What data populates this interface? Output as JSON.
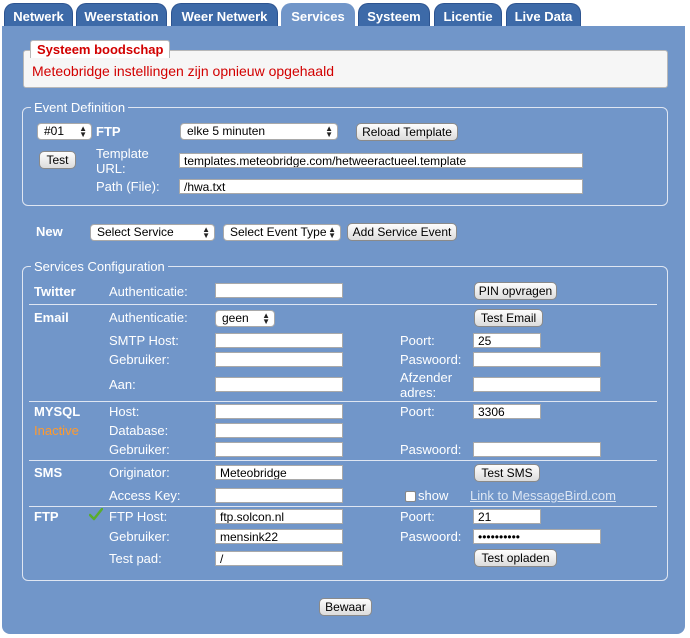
{
  "tabs": [
    "Netwerk",
    "Weerstation",
    "Weer Netwerk",
    "Services",
    "Systeem",
    "Licentie",
    "Live Data"
  ],
  "message": {
    "title": "Systeem boodschap",
    "text": "Meteobridge instellingen zijn opnieuw opgehaald"
  },
  "event": {
    "legend": "Event Definition",
    "number": "#01",
    "type_label": "FTP",
    "interval": "elke 5 minuten",
    "reload_label": "Reload Template",
    "test_label": "Test",
    "template_label_1": "Template",
    "template_label_2": "URL:",
    "template_url": "templates.meteobridge.com/hetweeractueel.template",
    "path_label": "Path (File):",
    "path_value": "/hwa.txt"
  },
  "new_row": {
    "label": "New",
    "service_select": "Select Service",
    "event_type_select": "Select Event Type",
    "add_label": "Add Service Event"
  },
  "services": {
    "legend": "Services Configuration",
    "twitter": {
      "label": "Twitter",
      "auth_label": "Authenticatie:",
      "auth_value": "",
      "pin_label": "PIN opvragen"
    },
    "email": {
      "label": "Email",
      "auth_label": "Authenticatie:",
      "auth_value": "geen",
      "test_label": "Test Email",
      "smtp_label": "SMTP Host:",
      "smtp_value": "",
      "port_label": "Poort:",
      "port_value": "25",
      "user_label": "Gebruiker:",
      "user_value": "",
      "pass_label": "Paswoord:",
      "pass_value": "",
      "to_label": "Aan:",
      "to_value": "",
      "from_label_1": "Afzender",
      "from_label_2": "adres:",
      "from_value": ""
    },
    "mysql": {
      "label": "MYSQL",
      "status": "Inactive",
      "host_label": "Host:",
      "host_value": "",
      "port_label": "Poort:",
      "port_value": "3306",
      "db_label": "Database:",
      "db_value": "",
      "user_label": "Gebruiker:",
      "user_value": "",
      "pass_label": "Paswoord:",
      "pass_value": ""
    },
    "sms": {
      "label": "SMS",
      "orig_label": "Originator:",
      "orig_value": "Meteobridge",
      "test_label": "Test SMS",
      "key_label": "Access Key:",
      "key_value": "",
      "show_label": "show",
      "link_label": "Link to MessageBird.com"
    },
    "ftp": {
      "label": "FTP",
      "host_label": "FTP Host:",
      "host_value": "ftp.solcon.nl",
      "port_label": "Poort:",
      "port_value": "21",
      "user_label": "Gebruiker:",
      "user_value": "mensink22",
      "pass_label": "Paswoord:",
      "pass_value": "••••••••••",
      "path_label": "Test pad:",
      "path_value": "/",
      "upload_label": "Test opladen"
    }
  },
  "save_label": "Bewaar",
  "colors": {
    "panel": "#7196c9",
    "tab": "#3d6aa8",
    "message": "#d20000",
    "inactive": "#ff9a2e",
    "check": "#5aad2c"
  }
}
